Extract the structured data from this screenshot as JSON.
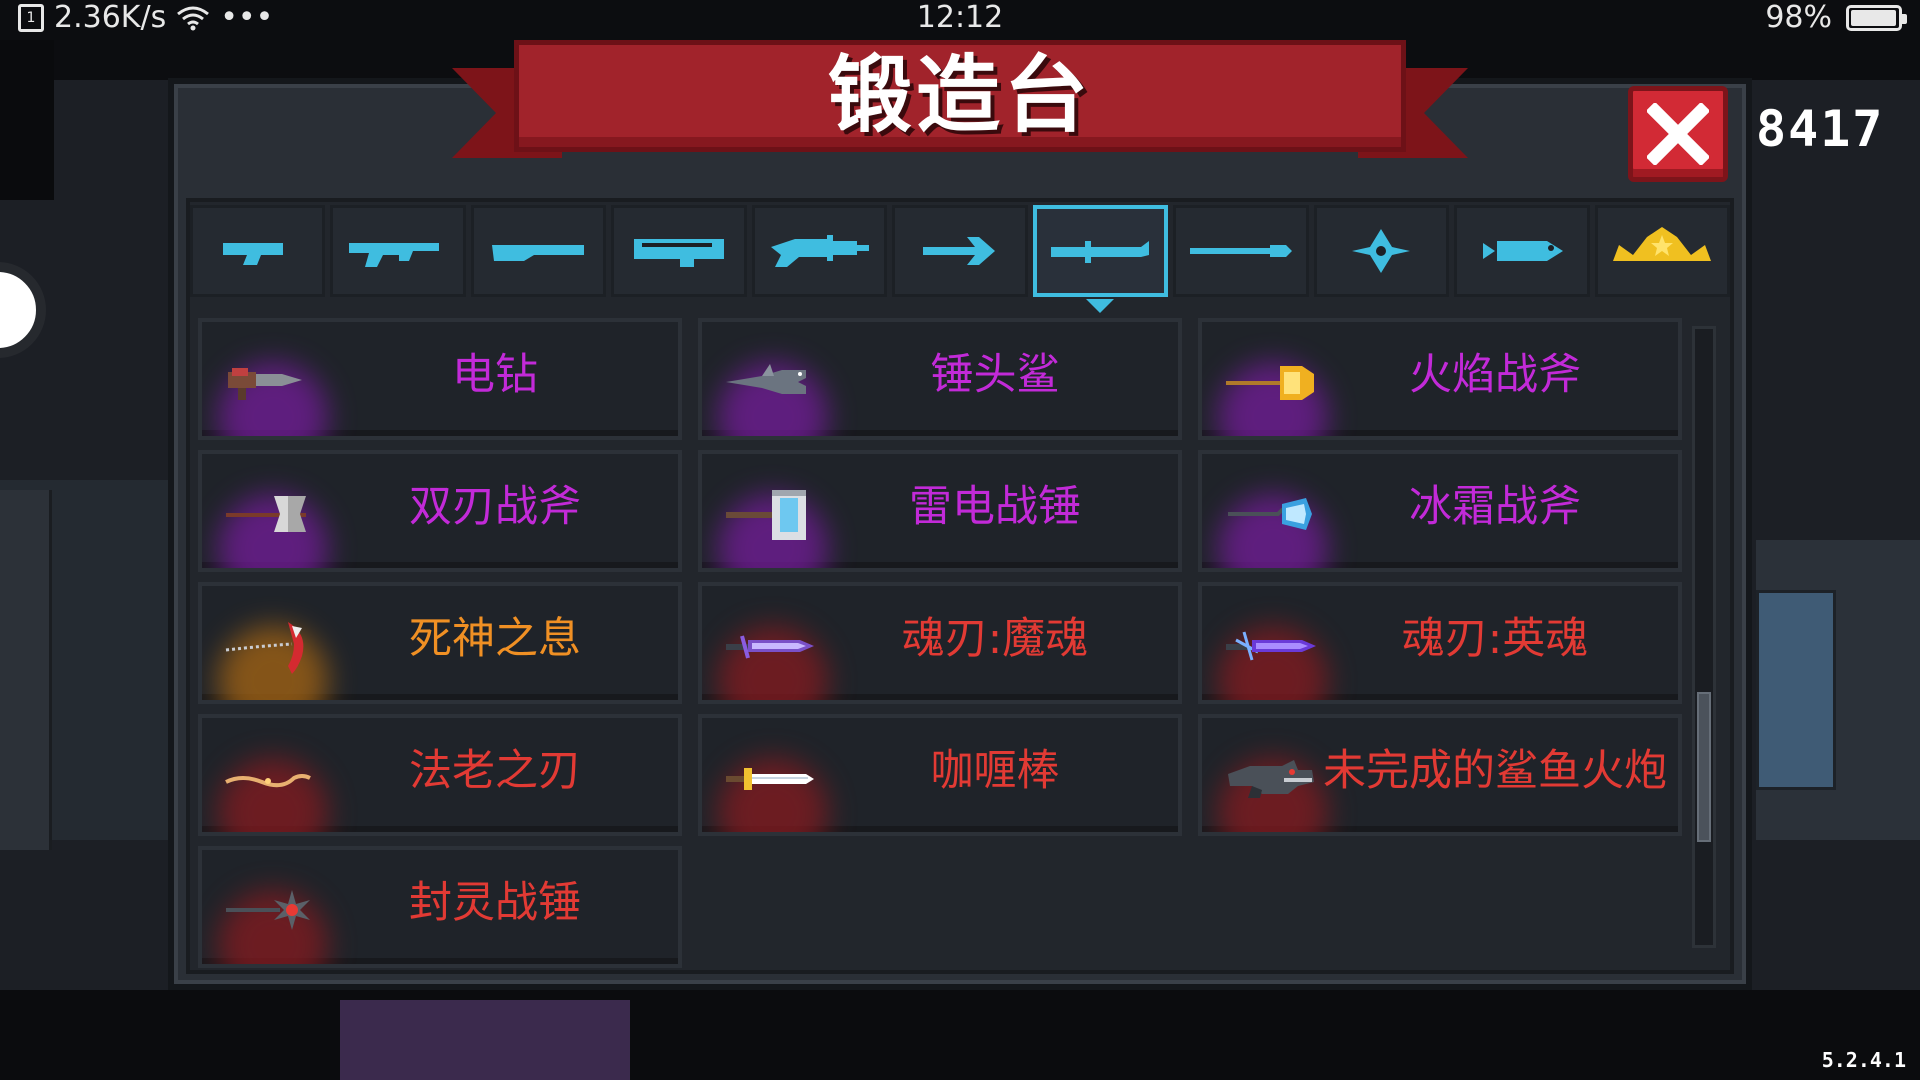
{
  "status_bar": {
    "network_speed": "2.36K/s",
    "more": "•••",
    "time": "12:12",
    "battery": "98%",
    "battery_level": 0.98
  },
  "panel": {
    "title": "锻造台",
    "gem_count": "8417"
  },
  "tabs": [
    {
      "icon": "pistol-icon",
      "selected": false
    },
    {
      "icon": "rifle-icon",
      "selected": false
    },
    {
      "icon": "shotgun-icon",
      "selected": false
    },
    {
      "icon": "launcher-icon",
      "selected": false
    },
    {
      "icon": "laser-gun-icon",
      "selected": false
    },
    {
      "icon": "arrow-bow-icon",
      "selected": false
    },
    {
      "icon": "melee-weapon-icon",
      "selected": true
    },
    {
      "icon": "spear-icon",
      "selected": false
    },
    {
      "icon": "shuriken-icon",
      "selected": false
    },
    {
      "icon": "fish-icon",
      "selected": false
    },
    {
      "icon": "crown-icon",
      "selected": false
    }
  ],
  "weapons": [
    {
      "name": "电钻",
      "rarity": "purple",
      "icon": "drill-icon"
    },
    {
      "name": "锤头鲨",
      "rarity": "purple",
      "icon": "hammerhead-shark-icon"
    },
    {
      "name": "火焰战斧",
      "rarity": "purple",
      "icon": "flame-axe-icon"
    },
    {
      "name": "双刃战斧",
      "rarity": "purple",
      "icon": "double-axe-icon"
    },
    {
      "name": "雷电战锤",
      "rarity": "purple",
      "icon": "thunder-hammer-icon"
    },
    {
      "name": "冰霜战斧",
      "rarity": "purple",
      "icon": "frost-axe-icon"
    },
    {
      "name": "死神之息",
      "rarity": "orange",
      "icon": "scythe-icon"
    },
    {
      "name": "魂刃:魔魂",
      "rarity": "red",
      "icon": "soul-blade-demon-icon"
    },
    {
      "name": "魂刃:英魂",
      "rarity": "red",
      "icon": "soul-blade-hero-icon"
    },
    {
      "name": "法老之刃",
      "rarity": "red",
      "icon": "pharaoh-blade-icon"
    },
    {
      "name": "咖喱棒",
      "rarity": "red",
      "icon": "excalibur-icon"
    },
    {
      "name": "未完成的鲨鱼火炮",
      "rarity": "red",
      "icon": "shark-cannon-icon"
    },
    {
      "name": "封灵战锤",
      "rarity": "red",
      "icon": "seal-hammer-icon"
    }
  ],
  "scroll_position": 0.78,
  "version": "5.2.4.1",
  "colors": {
    "tab_icon": "#3fbde0",
    "crown_icon": "#f0c020",
    "ribbon": "#a1232b",
    "close_button": "#d22a35",
    "purple_text": "#c22ad8",
    "orange_text": "#f09024",
    "red_text": "#e23a34"
  }
}
